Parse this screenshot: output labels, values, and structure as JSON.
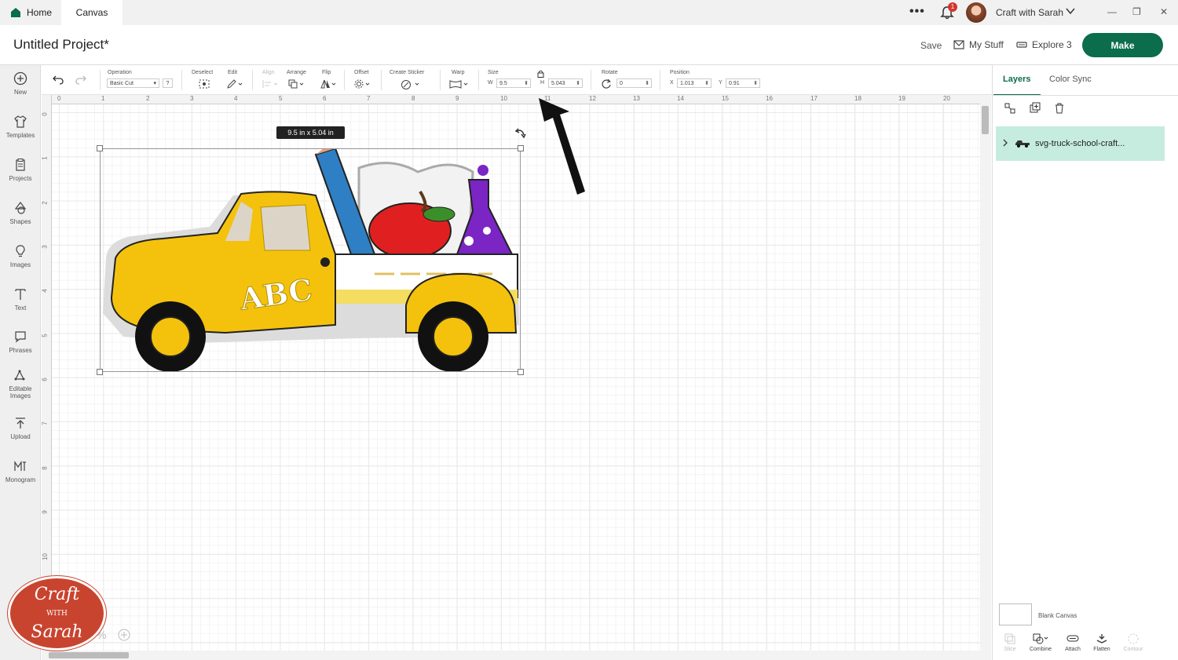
{
  "tabs": {
    "home": "Home",
    "canvas": "Canvas"
  },
  "topbar": {
    "more": "•••",
    "notification_count": "1",
    "account": "Craft with Sarah",
    "minimize": "—",
    "restore": "❐",
    "close": "✕"
  },
  "header": {
    "title": "Untitled Project*",
    "save": "Save",
    "my_stuff": "My Stuff",
    "machine": "Explore 3",
    "make": "Make"
  },
  "sidebar": [
    {
      "label": "New",
      "icon": "plus-circle-icon"
    },
    {
      "label": "Templates",
      "icon": "shirt-icon"
    },
    {
      "label": "Projects",
      "icon": "clipboard-icon"
    },
    {
      "label": "Shapes",
      "icon": "shapes-icon"
    },
    {
      "label": "Images",
      "icon": "lightbulb-icon"
    },
    {
      "label": "Text",
      "icon": "text-icon"
    },
    {
      "label": "Phrases",
      "icon": "speech-bubble-icon"
    },
    {
      "label": "Editable Images",
      "icon": "edit-image-icon"
    },
    {
      "label": "Upload",
      "icon": "upload-icon"
    },
    {
      "label": "Monogram",
      "icon": "monogram-icon"
    }
  ],
  "toolbar": {
    "operation_label": "Operation",
    "operation_value": "Basic Cut",
    "help": "?",
    "deselect": "Deselect",
    "edit": "Edit",
    "align": "Align",
    "arrange": "Arrange",
    "flip": "Flip",
    "offset": "Offset",
    "create_sticker": "Create Sticker",
    "warp": "Warp",
    "size_label": "Size",
    "w_label": "W",
    "w_value": "9.5",
    "h_label": "H",
    "h_value": "5.043",
    "rotate_label": "Rotate",
    "rotate_value": "0",
    "position_label": "Position",
    "x_label": "X",
    "x_value": "1.013",
    "y_label": "Y",
    "y_value": "0.91"
  },
  "ruler": {
    "top": [
      "0",
      "1",
      "2",
      "3",
      "4",
      "5",
      "6",
      "7",
      "8",
      "9",
      "10",
      "11",
      "12",
      "13",
      "14",
      "15",
      "16",
      "17",
      "18",
      "19",
      "20"
    ],
    "left": [
      "0",
      "1",
      "2",
      "3",
      "4",
      "5",
      "6",
      "7",
      "8",
      "9",
      "10"
    ]
  },
  "canvas": {
    "size_tooltip": "9.5  in x 5.04  in",
    "zoom": "%"
  },
  "panel": {
    "tab_layers": "Layers",
    "tab_color_sync": "Color Sync",
    "layer_name": "svg-truck-school-craft...",
    "blank_canvas": "Blank Canvas",
    "bottom_tools": [
      "Slice",
      "Combine",
      "Attach",
      "Flatten",
      "Contour"
    ]
  },
  "logo": {
    "line1": "Craft",
    "line2": "WITH",
    "line3": "Sarah"
  },
  "design": {
    "truck_text": "ABC"
  },
  "colors": {
    "brand_green": "#0b6d4b",
    "layer_highlight": "#c6ece0",
    "truck_yellow": "#f4c20d"
  }
}
